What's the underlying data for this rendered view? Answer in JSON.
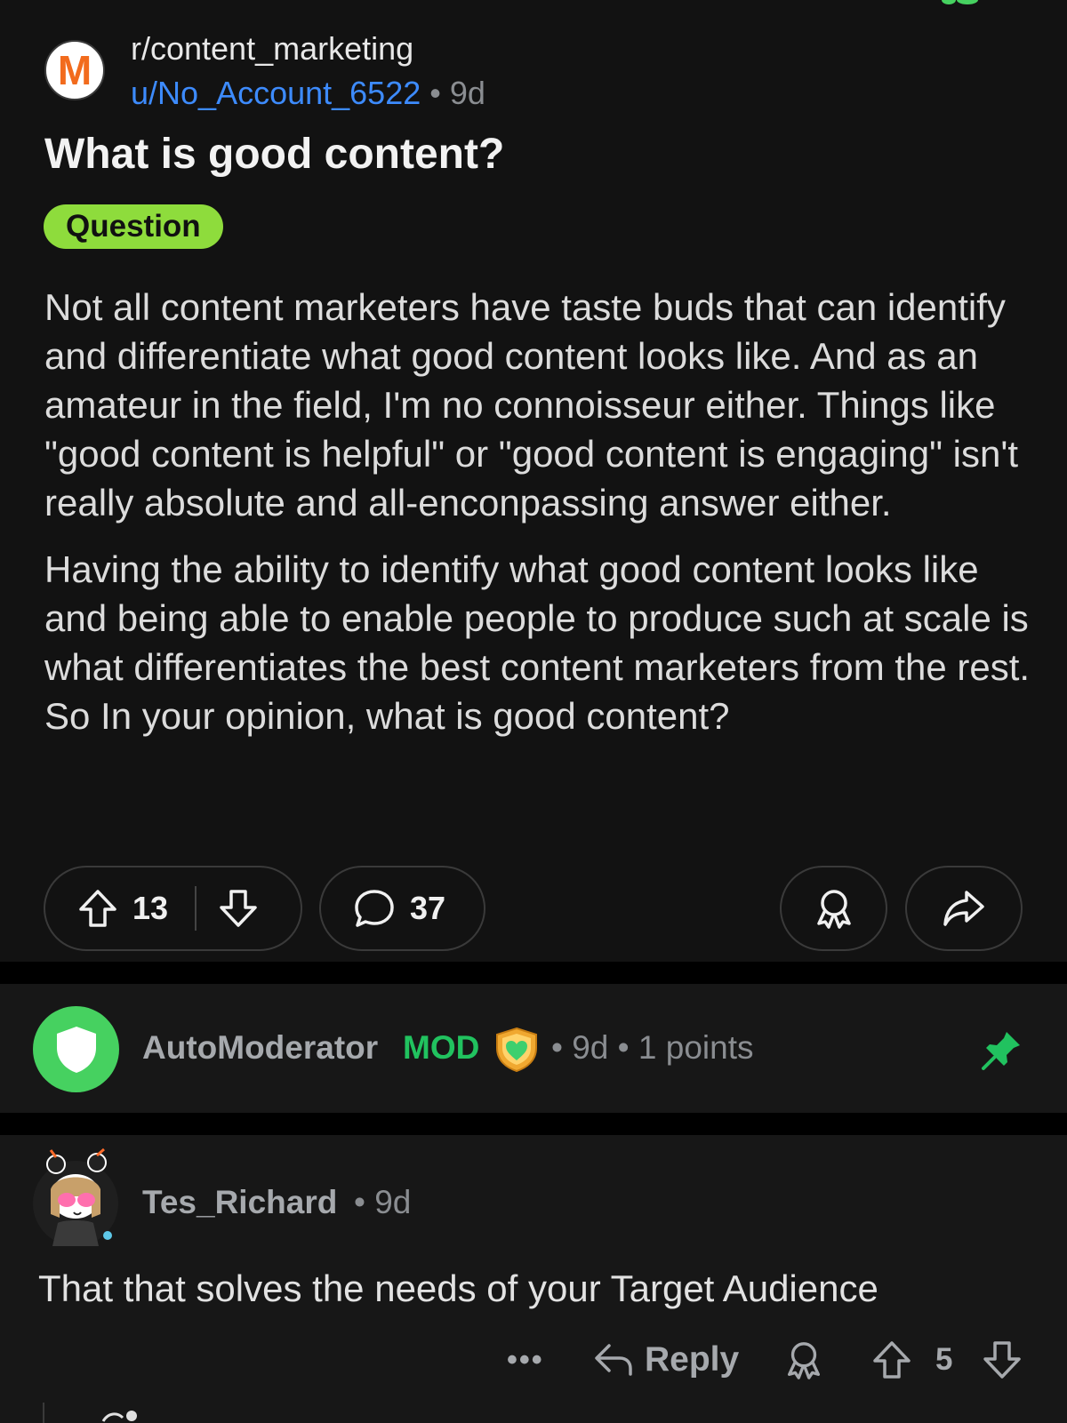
{
  "post": {
    "subreddit": "r/content_marketing",
    "subreddit_icon_letter": "M",
    "author": "u/No_Account_6522",
    "separator": "•",
    "age": "9d",
    "title": "What is good content?",
    "flair": "Question",
    "flair_color": "#8edc3c",
    "body": [
      "Not all content marketers have taste buds that can identify and differentiate what good content looks like. And as an amateur in the field, I'm no connoisseur either. Things like \"good content is helpful\" or \"good content is engaging\" isn't really absolute and all-enconpassing answer either.",
      "Having the ability to identify what good content looks like and being able to enable people to produce such at scale is what differentiates the best content marketers from the rest. So In your opinion, what is good content?"
    ],
    "upvotes": "13",
    "comments": "37",
    "icons": [
      "upvote-icon",
      "downvote-icon",
      "comment-icon",
      "award-icon",
      "share-icon"
    ]
  },
  "automod": {
    "name": "AutoModerator",
    "mod_label": "MOD",
    "meta": "• 9d • 1 points",
    "avatar_color": "#46d160",
    "mod_color": "#21c25f",
    "pin_color": "#21c25f"
  },
  "comment": {
    "author": "Tes_Richard",
    "meta": "• 9d",
    "text": "That that solves the needs of your Target Audience",
    "more": "•••",
    "reply_label": "Reply",
    "score": "5"
  },
  "colors": {
    "background": "#121212",
    "link_blue": "#3d8bfd"
  }
}
